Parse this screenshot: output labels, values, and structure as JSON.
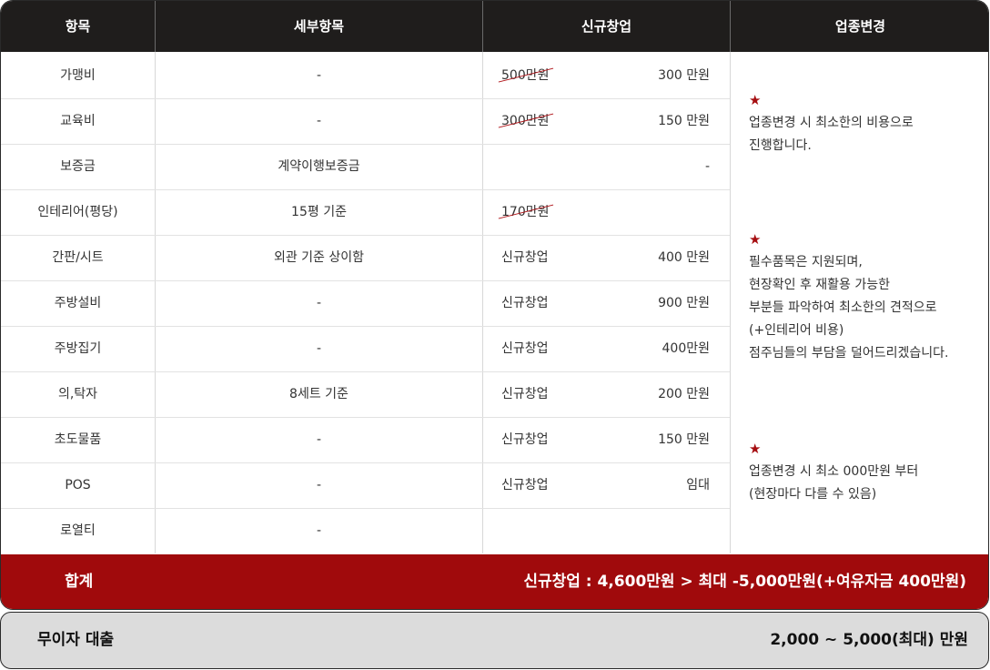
{
  "header": {
    "item": "항목",
    "detail": "세부항목",
    "new_startup": "신규창업",
    "conversion": "업종변경"
  },
  "rows": [
    {
      "item": "가맹비",
      "detail": "-",
      "left": "500만원",
      "left_struck": true,
      "right": "300 만원"
    },
    {
      "item": "교육비",
      "detail": "-",
      "left": "300만원",
      "left_struck": true,
      "right": "150 만원"
    },
    {
      "item": "보증금",
      "detail": "계약이행보증금",
      "left": "",
      "left_struck": false,
      "right": "-"
    },
    {
      "item": "인테리어(평당)",
      "detail": "15평 기준",
      "left": "170만원",
      "left_struck": true,
      "right": ""
    },
    {
      "item": "간판/시트",
      "detail": "외관 기준 상이함",
      "left": "신규창업",
      "left_struck": false,
      "right": "400 만원"
    },
    {
      "item": "주방설비",
      "detail": "-",
      "left": "신규창업",
      "left_struck": false,
      "right": "900 만원"
    },
    {
      "item": "주방집기",
      "detail": "-",
      "left": "신규창업",
      "left_struck": false,
      "right": "400만원"
    },
    {
      "item": "의,탁자",
      "detail": "8세트 기준",
      "left": "신규창업",
      "left_struck": false,
      "right": "200 만원"
    },
    {
      "item": "초도물품",
      "detail": "-",
      "left": "신규창업",
      "left_struck": false,
      "right": "150 만원"
    },
    {
      "item": "POS",
      "detail": "-",
      "left": "신규창업",
      "left_struck": false,
      "right": "임대"
    },
    {
      "item": "로열티",
      "detail": "-",
      "left": "",
      "left_struck": false,
      "right": ""
    }
  ],
  "notes": {
    "star": "★",
    "note1": [
      "업종변경 시 최소한의 비용으로",
      "진행합니다."
    ],
    "note2": [
      "필수품목은 지원되며,",
      "현장확인 후 재활용 가능한",
      "부분들 파악하여 최소한의 견적으로",
      "(+인테리어 비용)",
      "점주님들의 부담을 덜어드리겠습니다."
    ],
    "note3": [
      "업종변경 시 최소 000만원 부터",
      "(현장마다 다를 수 있음)"
    ]
  },
  "total": {
    "label": "합계",
    "value": "신규창업 : 4,600만원  >  최대 -5,000만원(+여유자금 400만원)"
  },
  "loan": {
    "label": "무이자 대출",
    "value": "2,000  ~ 5,000(최대) 만원"
  },
  "colors": {
    "header_bg": "#1f1d1c",
    "total_bg": "#a00a0c",
    "accent_red": "#a50d10",
    "loan_bg": "#dcdcdc"
  }
}
